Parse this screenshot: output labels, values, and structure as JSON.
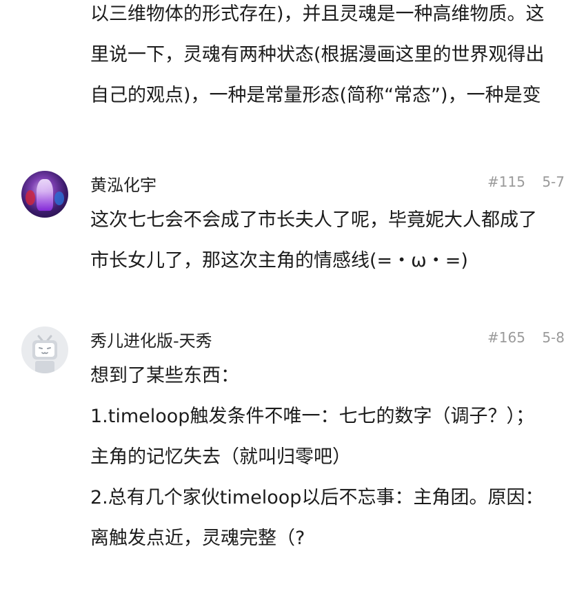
{
  "top_post": {
    "lines": [
      "以三维物体的形式存在)，并且灵魂是一种高维物质。这",
      "里说一下，灵魂有两种状态(根据漫画这里的世界观得出",
      "自己的观点)，一种是常量形态(简称“常态”)，一种是变"
    ]
  },
  "comments": [
    {
      "username": "黄泓化宇",
      "floor": "#115",
      "date": "5-7",
      "lines": [
        "这次七七会不会成了市长夫人了呢，毕竟妮大人都成了",
        "市长女儿了，那这次主角的情感线(=・ω・=)"
      ]
    },
    {
      "username": "秀儿进化版-天秀",
      "floor": "#165",
      "date": "5-8",
      "lines": [
        "想到了某些东西：",
        "1.timeloop触发条件不唯一：七七的数字（调子？）；",
        "主角的记忆失去（就叫归零吧）",
        "2.总有几个家伙timeloop以后不忘事：主角团。原因：",
        "离触发点近，灵魂完整（?"
      ]
    }
  ]
}
